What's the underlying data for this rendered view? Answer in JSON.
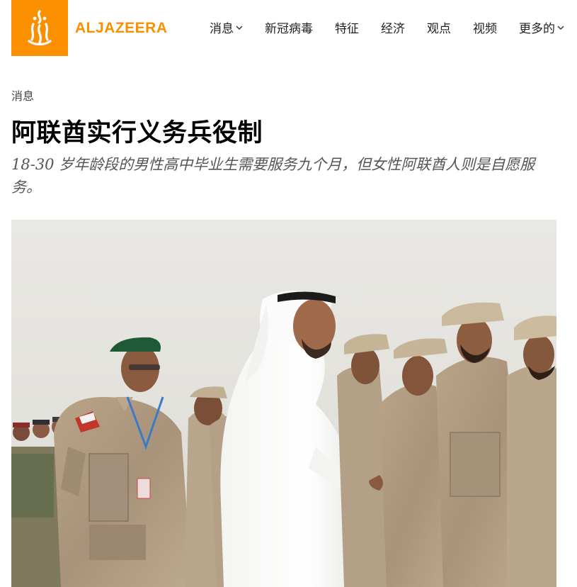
{
  "header": {
    "brand": "ALJAZEERA",
    "brand_color": "#fa9000",
    "nav": [
      {
        "label": "消息",
        "dropdown": true
      },
      {
        "label": "新冠病毒",
        "dropdown": false
      },
      {
        "label": "特征",
        "dropdown": false
      },
      {
        "label": "经济",
        "dropdown": false
      },
      {
        "label": "观点",
        "dropdown": false
      },
      {
        "label": "视频",
        "dropdown": false
      },
      {
        "label": "更多的",
        "dropdown": true
      }
    ]
  },
  "article": {
    "kicker": "消息",
    "title": "阿联酋实行义务兵役制",
    "subtitle": "18-30 岁年龄段的男性高中毕业生需要服务九个月，但女性阿联酋人则是自愿服务。"
  }
}
